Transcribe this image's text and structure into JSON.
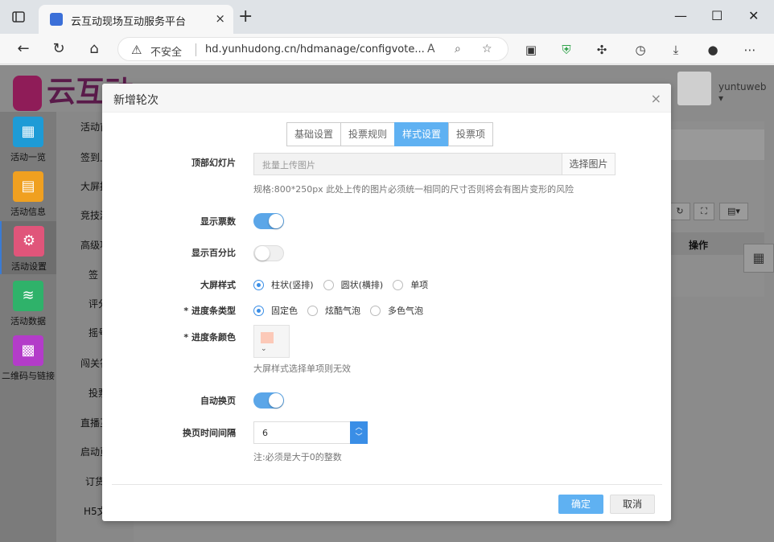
{
  "browser": {
    "tab_title": "云互动现场互动服务平台",
    "insecure_label": "不安全",
    "url": "hd.yunhudong.cn/hdmanage/configvote...",
    "tab_close": "×",
    "new_tab": "+"
  },
  "header": {
    "logo_text": "云互动",
    "username": "yuntuweb ▾"
  },
  "leftnav": {
    "items": [
      {
        "label": "活动一览",
        "icon": "grid-icon",
        "color": "#1e9bd6"
      },
      {
        "label": "活动信息",
        "icon": "document-icon",
        "color": "#f0a020"
      },
      {
        "label": "活动设置",
        "icon": "gear-icon",
        "color": "#e0557a"
      },
      {
        "label": "活动数据",
        "icon": "database-icon",
        "color": "#2fb26a"
      },
      {
        "label": "二维码与链接",
        "icon": "qrcode-icon",
        "color": "#b33cc9"
      }
    ]
  },
  "subnav": {
    "items": [
      "活动首",
      "签到上",
      "大屏挂",
      "竞技游",
      "高级功",
      "签",
      "评分",
      "摇号",
      "闯关答",
      "投票",
      "直播互",
      "启动页",
      "订货",
      "H5文"
    ]
  },
  "content": {
    "col_action": "操作"
  },
  "modal": {
    "title": "新增轮次",
    "close": "×",
    "tabs": [
      {
        "label": "基础设置",
        "active": false
      },
      {
        "label": "投票规则",
        "active": false
      },
      {
        "label": "样式设置",
        "active": true
      },
      {
        "label": "投票项",
        "active": false
      }
    ],
    "slideshow": {
      "label": "顶部幻灯片",
      "placeholder": "批量上传图片",
      "button": "选择图片",
      "hint": "规格:800*250px 此处上传的图片必须统一相同的尺寸否则将会有图片变形的风险"
    },
    "show_votes": {
      "label": "显示票数",
      "on": true
    },
    "show_percent": {
      "label": "显示百分比",
      "on": false
    },
    "screen_style": {
      "label": "大屏样式",
      "options": [
        "柱状(竖排)",
        "圆状(横排)",
        "单项"
      ],
      "selected": 0
    },
    "progress_type": {
      "label": "* 进度条类型",
      "options": [
        "固定色",
        "炫酷气泡",
        "多色气泡"
      ],
      "selected": 0
    },
    "progress_color": {
      "label": "* 进度条颜色",
      "value": "#fcc9b8",
      "hint": "大屏样式选择单项则无效"
    },
    "auto_page": {
      "label": "自动换页",
      "on": true
    },
    "page_interval": {
      "label": "换页时间间隔",
      "value": "6",
      "hint": "注:必须是大于0的整数"
    },
    "ok": "确定",
    "cancel": "取消"
  }
}
